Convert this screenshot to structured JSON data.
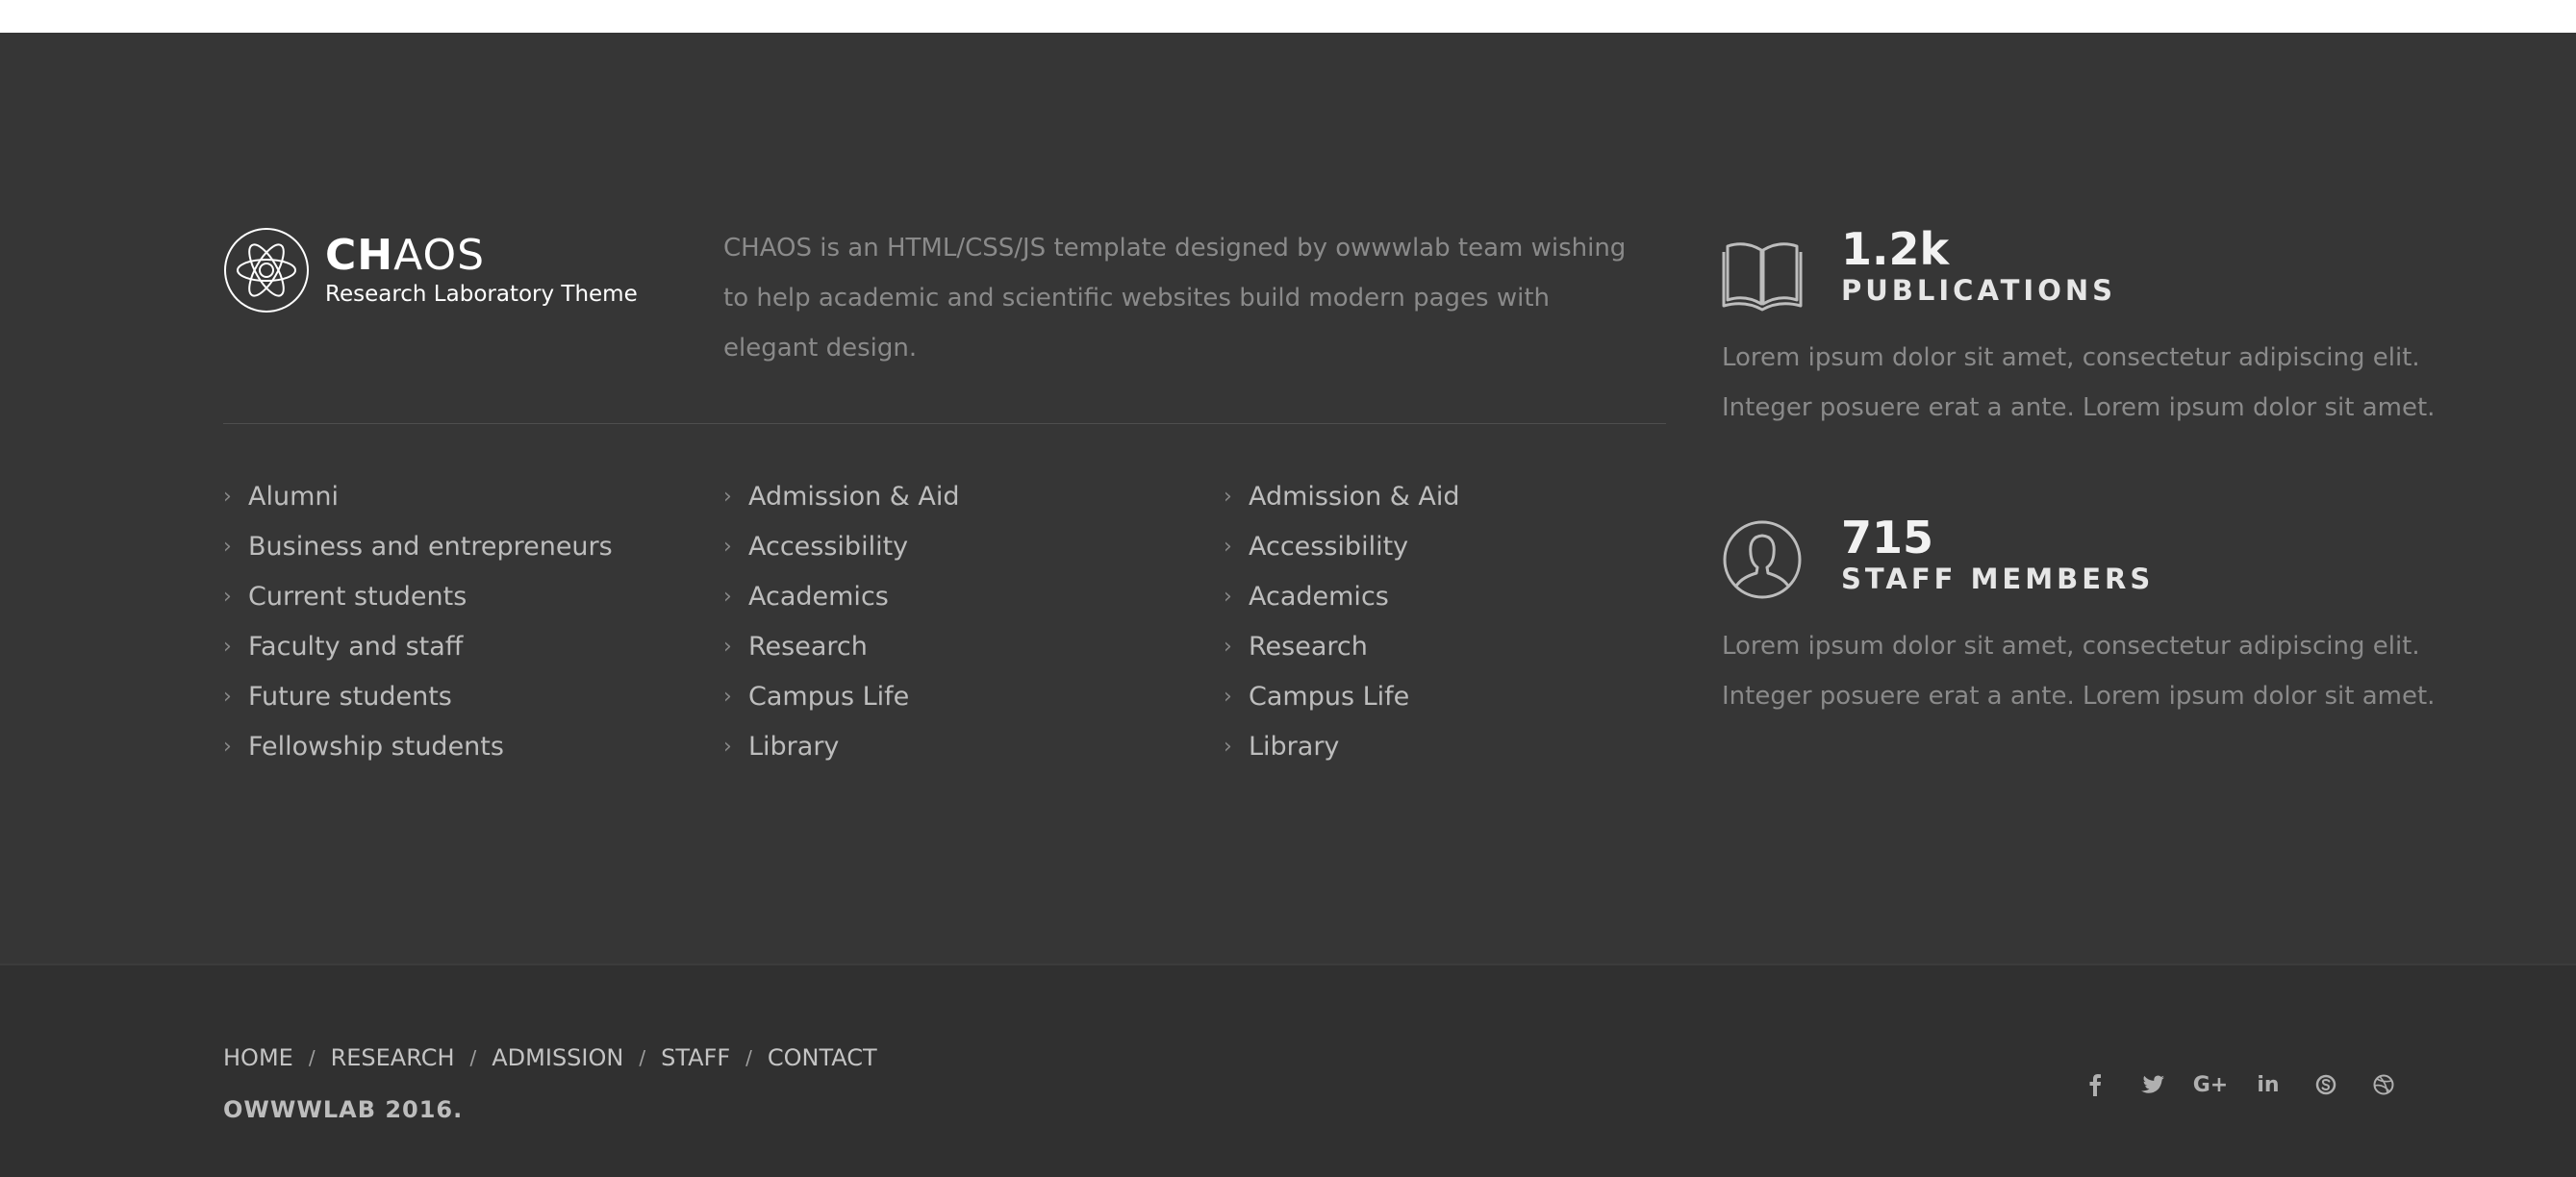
{
  "logo": {
    "name_bold": "CH",
    "name_light": "AOS",
    "tagline": "Research Laboratory Theme"
  },
  "about": "CHAOS is an HTML/CSS/JS template designed by owwwlab team wishing to help academic and scientific websites build modern pages with elegant design.",
  "links": {
    "col1": [
      "Alumni",
      "Business and entrepreneurs",
      "Current students",
      "Faculty and staff",
      "Future students",
      "Fellowship students"
    ],
    "col2": [
      "Admission & Aid",
      "Accessibility",
      "Academics",
      "Research",
      "Campus Life",
      "Library"
    ],
    "col3": [
      "Admission & Aid",
      "Accessibility",
      "Academics",
      "Research",
      "Campus Life",
      "Library"
    ]
  },
  "stats": [
    {
      "icon": "book-icon",
      "number": "1.2k",
      "label": "PUBLICATIONS",
      "desc": "Lorem ipsum dolor sit amet, consectetur adipiscing elit. Integer posuere erat a ante. Lorem ipsum dolor sit amet."
    },
    {
      "icon": "user-profile-icon",
      "number": "715",
      "label": "STAFF MEMBERS",
      "desc": "Lorem ipsum dolor sit amet, consectetur adipiscing elit. Integer posuere erat a ante. Lorem ipsum dolor sit amet."
    }
  ],
  "bottom_nav": [
    "HOME",
    "RESEARCH",
    "ADMISSION",
    "STAFF",
    "CONTACT"
  ],
  "nav_separator": "/",
  "copyright": "OWWWLAB 2016.",
  "social": [
    "facebook-icon",
    "twitter-icon",
    "google-plus-icon",
    "linkedin-icon",
    "skype-icon",
    "dribbble-icon"
  ],
  "social_labels": {
    "gplus": "G+",
    "linkedin": "in"
  },
  "colors": {
    "footer_bg": "#363636",
    "bottom_bg": "#303030",
    "text_muted": "#8a8a8a"
  }
}
